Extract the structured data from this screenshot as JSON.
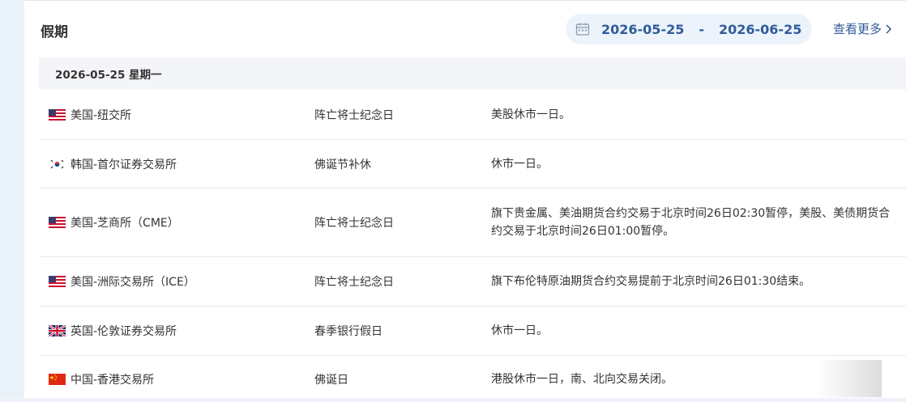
{
  "title": "假期",
  "date_range": {
    "start": "2026-05-25",
    "separator": "-",
    "end": "2026-06-25"
  },
  "more_label": "查看更多",
  "day_header": "2026-05-25 星期一",
  "rows": [
    {
      "flag": "us",
      "exchange": "美国-纽交所",
      "holiday": "阵亡将士纪念日",
      "description": "美股休市一日。"
    },
    {
      "flag": "kr",
      "exchange": "韩国-首尔证券交易所",
      "holiday": "佛诞节补休",
      "description": "休市一日。"
    },
    {
      "flag": "us",
      "exchange": "美国-芝商所（CME）",
      "holiday": "阵亡将士纪念日",
      "description": "旗下贵金属、美油期货合约交易于北京时间26日02:30暂停，美股、美债期货合约交易于北京时间26日01:00暂停。"
    },
    {
      "flag": "us",
      "exchange": "美国-洲际交易所（ICE）",
      "holiday": "阵亡将士纪念日",
      "description": "旗下布伦特原油期货合约交易提前于北京时间26日01:30结束。"
    },
    {
      "flag": "gb",
      "exchange": "英国-伦敦证券交易所",
      "holiday": "春季银行假日",
      "description": "休市一日。"
    },
    {
      "flag": "cn",
      "exchange": "中国-香港交易所",
      "holiday": "佛诞日",
      "description": "港股休市一日，南、北向交易关闭。"
    }
  ],
  "colors": {
    "accent": "#2f5b9a",
    "pill_bg": "#edf3fb",
    "day_header_bg": "#f3f5f8"
  }
}
